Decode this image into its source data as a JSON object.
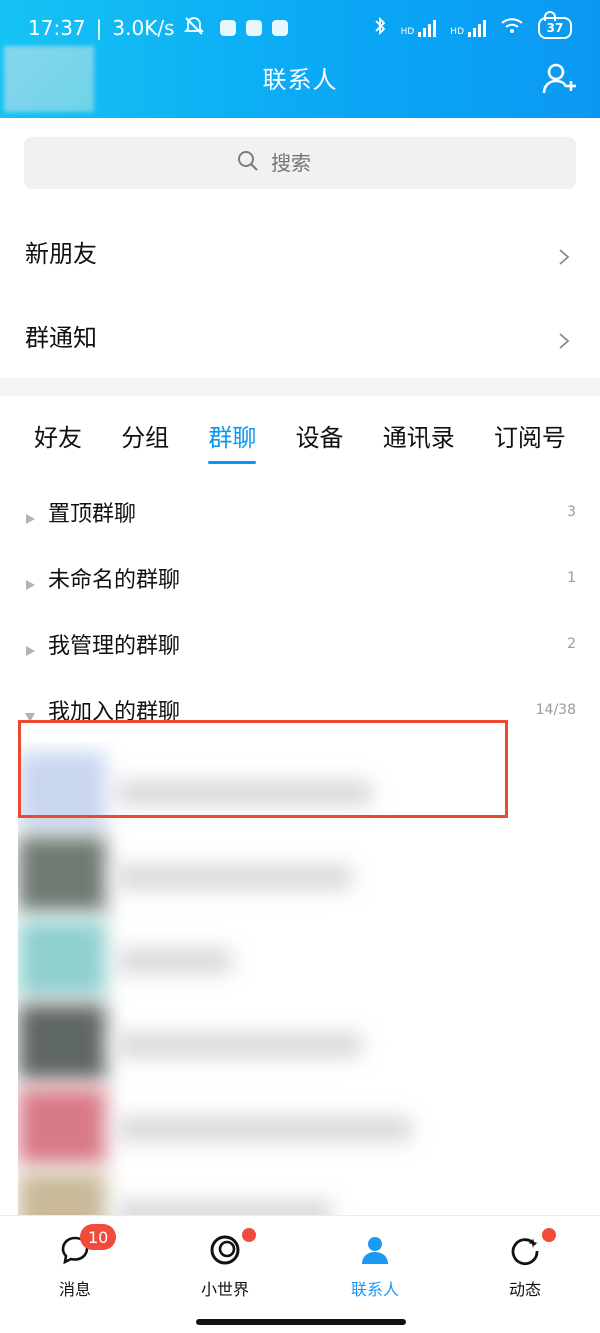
{
  "status": {
    "time": "17:37",
    "speed": "3.0K/s",
    "hd1": "HD",
    "hd2": "HD",
    "battery": "37"
  },
  "header": {
    "title": "联系人"
  },
  "search": {
    "placeholder": "搜索"
  },
  "rows": {
    "new_friends": "新朋友",
    "group_notice": "群通知"
  },
  "tabs": [
    {
      "label": "好友"
    },
    {
      "label": "分组"
    },
    {
      "label": "群聊"
    },
    {
      "label": "设备"
    },
    {
      "label": "通讯录"
    },
    {
      "label": "订阅号"
    }
  ],
  "groups": [
    {
      "label": "置顶群聊",
      "count": "3"
    },
    {
      "label": "未命名的群聊",
      "count": "1"
    },
    {
      "label": "我管理的群聊",
      "count": "2"
    },
    {
      "label": "我加入的群聊",
      "count": "14/38"
    }
  ],
  "bottom_nav": [
    {
      "label": "消息",
      "badge": "10"
    },
    {
      "label": "小世界"
    },
    {
      "label": "联系人"
    },
    {
      "label": "动态"
    }
  ],
  "colors": {
    "accent": "#0b98f2",
    "highlight_box": "#ea4a2e",
    "badge": "#f04b3b"
  }
}
